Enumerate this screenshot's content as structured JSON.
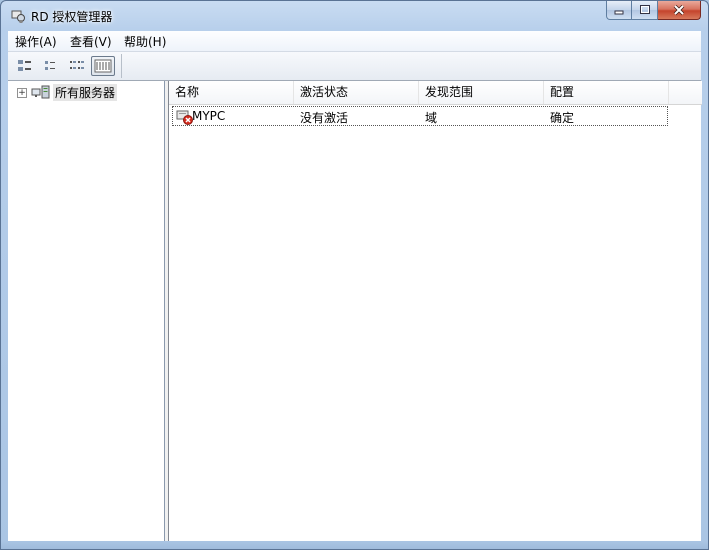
{
  "window": {
    "title": "RD 授权管理器"
  },
  "menu": [
    {
      "label": "操作(A)"
    },
    {
      "label": "查看(V)"
    },
    {
      "label": "帮助(H)"
    }
  ],
  "toolbar": {
    "buttons": [
      "large-icons",
      "small-icons",
      "list",
      "details"
    ],
    "active": "details"
  },
  "tree": {
    "root_label": "所有服务器",
    "expander": "+"
  },
  "list": {
    "columns": [
      "名称",
      "激活状态",
      "发现范围",
      "配置"
    ],
    "rows": [
      {
        "name": "MYPC",
        "activation": "没有激活",
        "scope": "域",
        "config": "确定",
        "status_icon": "server-error-icon"
      }
    ]
  },
  "colors": {
    "title_gradient": "#b7cfeb",
    "close_button": "#c5442c",
    "selection_gray": "#e5e5e5"
  }
}
